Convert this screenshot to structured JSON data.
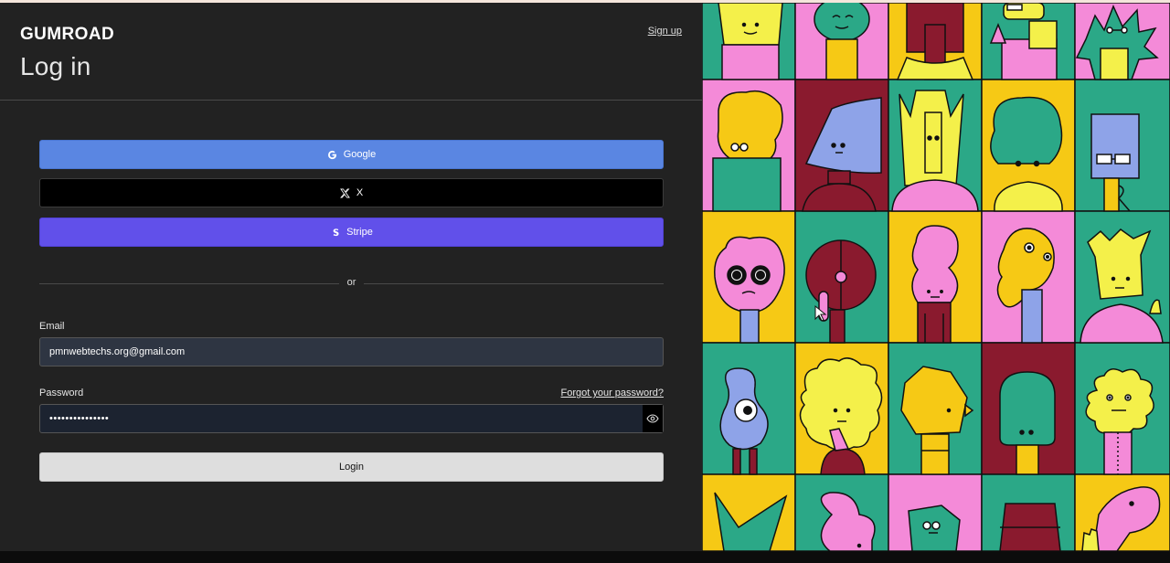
{
  "brand": {
    "logo_text": "GUMROAD"
  },
  "header": {
    "title": "Log in",
    "signup_link": "Sign up"
  },
  "oauth": {
    "google_label": "Google",
    "x_label": "X",
    "stripe_label": "Stripe",
    "google_icon": "G",
    "stripe_icon": "S"
  },
  "divider": {
    "text": "or"
  },
  "form": {
    "email_label": "Email",
    "email_value": "pmnwebtechs.org@gmail.com",
    "password_label": "Password",
    "password_value": "•••••••••••••••",
    "forgot_link": "Forgot your password?",
    "login_button": "Login"
  },
  "colors": {
    "google": "#5a86e2",
    "x": "#000000",
    "stripe": "#6150ea",
    "background": "#222222"
  },
  "icons": {
    "google": "google-icon",
    "x": "x-icon",
    "stripe": "stripe-icon",
    "reveal": "eye-icon"
  }
}
